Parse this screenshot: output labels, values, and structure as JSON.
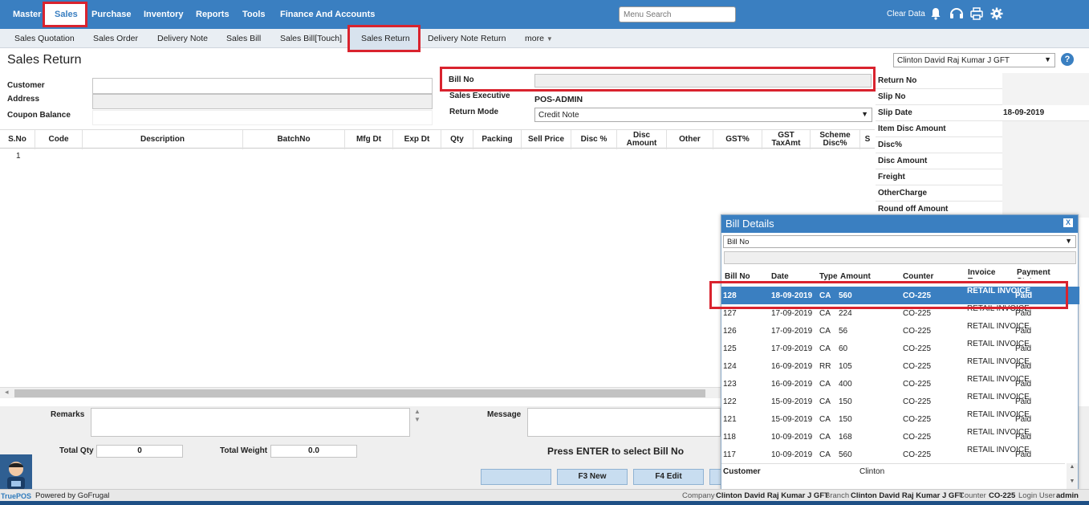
{
  "topnav": {
    "items": [
      "Master",
      "Sales",
      "Purchase",
      "Inventory",
      "Reports",
      "Tools",
      "Finance And Accounts"
    ],
    "search_placeholder": "Menu Search",
    "clear_data": "Clear Data"
  },
  "subnav": {
    "items": [
      "Sales Quotation",
      "Sales Order",
      "Delivery Note",
      "Sales Bill",
      "Sales Bill[Touch]",
      "Sales Return",
      "Delivery Note Return"
    ],
    "more": "more"
  },
  "page": {
    "title": "Sales Return",
    "company_selector": "Clinton David Raj Kumar J GFT"
  },
  "form": {
    "customer_label": "Customer",
    "address_label": "Address",
    "coupon_label": "Coupon Balance",
    "bill_no_label": "Bill No",
    "sales_exec_label": "Sales Executive",
    "sales_exec_value": "POS-ADMIN",
    "return_mode_label": "Return Mode",
    "return_mode_value": "Credit Note"
  },
  "grid": {
    "columns": [
      "S.No",
      "Code",
      "Description",
      "BatchNo",
      "Mfg Dt",
      "Exp Dt",
      "Qty",
      "Packing",
      "Sell Price",
      "Disc %",
      "Disc Amount",
      "Other",
      "GST%",
      "GST TaxAmt",
      "Scheme Disc%",
      "S"
    ],
    "first_row_sno": "1"
  },
  "summary": {
    "rows": [
      {
        "label": "Return No",
        "value": ""
      },
      {
        "label": "Slip No",
        "value": ""
      },
      {
        "label": "Slip Date",
        "value": "18-09-2019"
      },
      {
        "label": "Item Disc Amount",
        "value": ""
      },
      {
        "label": "Disc%",
        "value": ""
      },
      {
        "label": "Disc Amount",
        "value": ""
      },
      {
        "label": "Freight",
        "value": ""
      },
      {
        "label": "OtherCharge",
        "value": ""
      },
      {
        "label": "Round off Amount",
        "value": ""
      }
    ]
  },
  "popup": {
    "title": "Bill Details",
    "close": "X",
    "filter_value": "Bill No",
    "columns": [
      "Bill No",
      "Date",
      "Type",
      "Amount",
      "Counter",
      "Invoice Type",
      "Payment Status"
    ],
    "rows": [
      {
        "bill": "128",
        "date": "18-09-2019",
        "type": "CA",
        "amount": "560",
        "counter": "CO-225",
        "invoice": "RETAIL INVOICE",
        "status": "Paid"
      },
      {
        "bill": "127",
        "date": "17-09-2019",
        "type": "CA",
        "amount": "224",
        "counter": "CO-225",
        "invoice": "RETAIL INVOICE",
        "status": "Paid"
      },
      {
        "bill": "126",
        "date": "17-09-2019",
        "type": "CA",
        "amount": "56",
        "counter": "CO-225",
        "invoice": "RETAIL INVOICE",
        "status": "Paid"
      },
      {
        "bill": "125",
        "date": "17-09-2019",
        "type": "CA",
        "amount": "60",
        "counter": "CO-225",
        "invoice": "RETAIL INVOICE",
        "status": "Paid"
      },
      {
        "bill": "124",
        "date": "16-09-2019",
        "type": "RR",
        "amount": "105",
        "counter": "CO-225",
        "invoice": "RETAIL INVOICE",
        "status": "Paid"
      },
      {
        "bill": "123",
        "date": "16-09-2019",
        "type": "CA",
        "amount": "400",
        "counter": "CO-225",
        "invoice": "RETAIL INVOICE",
        "status": "Paid"
      },
      {
        "bill": "122",
        "date": "15-09-2019",
        "type": "CA",
        "amount": "150",
        "counter": "CO-225",
        "invoice": "RETAIL INVOICE",
        "status": "Paid"
      },
      {
        "bill": "121",
        "date": "15-09-2019",
        "type": "CA",
        "amount": "150",
        "counter": "CO-225",
        "invoice": "RETAIL INVOICE",
        "status": "Paid"
      },
      {
        "bill": "118",
        "date": "10-09-2019",
        "type": "CA",
        "amount": "168",
        "counter": "CO-225",
        "invoice": "RETAIL INVOICE",
        "status": "Paid"
      },
      {
        "bill": "117",
        "date": "10-09-2019",
        "type": "CA",
        "amount": "560",
        "counter": "CO-225",
        "invoice": "RETAIL INVOICE",
        "status": "Paid"
      }
    ],
    "customer_label": "Customer",
    "customer_value": "Clinton"
  },
  "bottom": {
    "remarks_label": "Remarks",
    "message_label": "Message",
    "total_qty_label": "Total Qty",
    "total_qty_value": "0",
    "total_weight_label": "Total Weight",
    "total_weight_value": "0.0",
    "press_enter": "Press ENTER to select Bill No",
    "btn_new": "F3 New",
    "btn_edit": "F4 Edit"
  },
  "footer": {
    "powered": "Powered by GoFrugal",
    "brand": "TruePOS",
    "company_label": "Company",
    "company_value": "Clinton David Raj Kumar J GFT",
    "branch_label": "Branch",
    "branch_value": "Clinton David Raj Kumar J GFT",
    "counter_label": "Counter",
    "counter_value": "CO-225",
    "login_label": "Login User",
    "login_value": "admin"
  },
  "colors": {
    "primary": "#3a7fc1",
    "highlight": "#d9232e"
  },
  "icons": [
    "bell-icon",
    "headset-icon",
    "printer-icon",
    "gear-icon",
    "help-icon"
  ]
}
